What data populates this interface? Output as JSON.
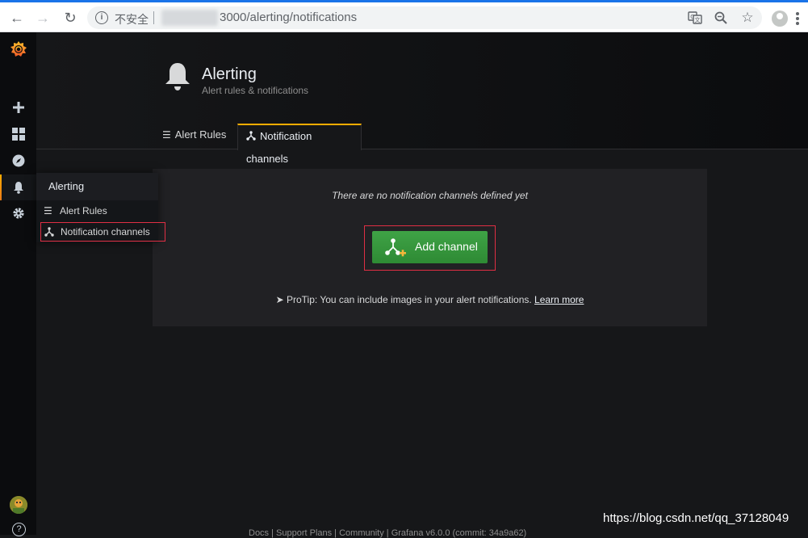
{
  "browser": {
    "security_label": "不安全",
    "url": "3000/alerting/notifications"
  },
  "header": {
    "title": "Alerting",
    "subtitle": "Alert rules & notifications"
  },
  "tabs": [
    {
      "label": "Alert Rules",
      "icon": "list-icon",
      "active": false
    },
    {
      "label": "Notification channels",
      "icon": "share-alt-icon",
      "active": true
    }
  ],
  "empty_state": {
    "message": "There are no notification channels defined yet",
    "add_button_label": "Add channel",
    "protip_text": "ProTip: You can include images in your alert notifications.",
    "learn_more_label": "Learn more"
  },
  "dropdown": {
    "title": "Alerting",
    "items": [
      {
        "label": "Alert Rules",
        "icon": "list-icon"
      },
      {
        "label": "Notification channels",
        "icon": "share-alt-icon"
      }
    ]
  },
  "sidemenu": {
    "icons": [
      "grafana-logo",
      "plus-icon",
      "dashboards-icon",
      "explore-icon",
      "bell-icon",
      "gear-icon",
      "avatar",
      "help-icon"
    ]
  },
  "footer": {
    "text": "Docs | Support Plans | Community | Grafana v6.0.0 (commit: 34a9a62)"
  },
  "watermark": "https://blog.csdn.net/qq_37128049",
  "colors": {
    "accent": "#ffac00",
    "success": "#299c46",
    "highlight_border": "#e02f44",
    "background": "#161719"
  }
}
